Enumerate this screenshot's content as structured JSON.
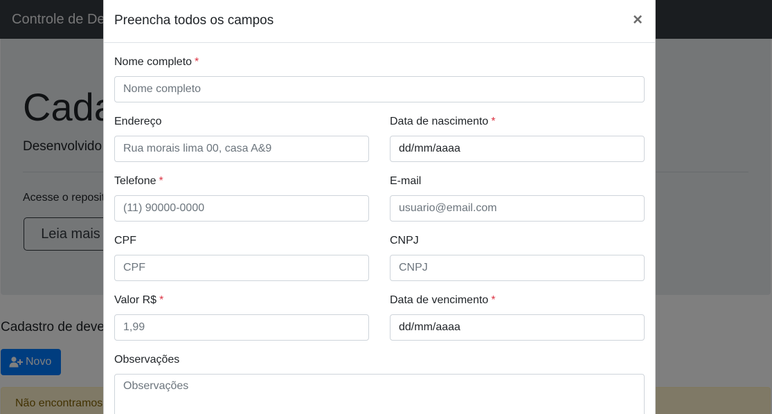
{
  "page": {
    "brand": "Controle de Dev",
    "jumbotron": {
      "title": "Cada",
      "lead": "Desenvolvido",
      "text": "Acesse o reposit",
      "button": "Leia mais"
    },
    "section_title": "Cadastro de deve",
    "new_button": "Novo",
    "alert": "Não encontramos"
  },
  "modal": {
    "title": "Preencha todos os campos",
    "close": "×",
    "required_mark": "*",
    "fields": {
      "nome": {
        "label": "Nome completo",
        "placeholder": "Nome completo"
      },
      "endereco": {
        "label": "Endereço",
        "placeholder": "Rua morais lima 00, casa A&9"
      },
      "nascimento": {
        "label": "Data de nascimento",
        "value": "dd/mm/aaaa"
      },
      "telefone": {
        "label": "Telefone",
        "placeholder": "(11) 90000-0000"
      },
      "email": {
        "label": "E-mail",
        "placeholder": "usuario@email.com"
      },
      "cpf": {
        "label": "CPF",
        "placeholder": "CPF"
      },
      "cnpj": {
        "label": "CNPJ",
        "placeholder": "CNPJ"
      },
      "valor": {
        "label": "Valor R$",
        "placeholder": "1,99"
      },
      "vencimento": {
        "label": "Data de vencimento",
        "value": "dd/mm/aaaa"
      },
      "observacoes": {
        "label": "Observações",
        "placeholder": "Observações"
      }
    }
  },
  "colors": {
    "primary": "#007bff",
    "required": "#dc3545",
    "navbar": "#343a40"
  }
}
